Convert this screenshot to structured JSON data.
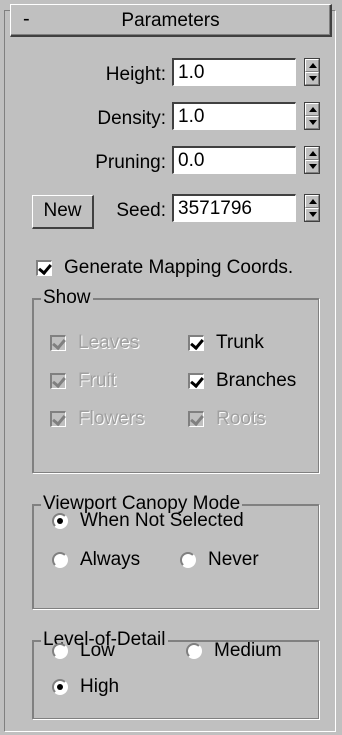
{
  "header": {
    "collapse_symbol": "-",
    "title": "Parameters"
  },
  "params": [
    {
      "label": "Height:",
      "value": "1.0"
    },
    {
      "label": "Density:",
      "value": "1.0"
    },
    {
      "label": "Pruning:",
      "value": "0.0"
    }
  ],
  "seed": {
    "button_label": "New",
    "label": "Seed:",
    "value": "3571796"
  },
  "generate_mapping": {
    "label": "Generate Mapping Coords.",
    "checked": true
  },
  "show": {
    "title": "Show",
    "items": [
      {
        "label": "Leaves",
        "checked": true,
        "disabled": true
      },
      {
        "label": "Trunk",
        "checked": true,
        "disabled": false
      },
      {
        "label": "Fruit",
        "checked": true,
        "disabled": true
      },
      {
        "label": "Branches",
        "checked": true,
        "disabled": false
      },
      {
        "label": "Flowers",
        "checked": true,
        "disabled": true
      },
      {
        "label": "Roots",
        "checked": true,
        "disabled": true
      }
    ]
  },
  "viewport_canopy": {
    "title": "Viewport Canopy Mode",
    "options": [
      {
        "label": "When Not Selected",
        "selected": true
      },
      {
        "label": "Always",
        "selected": false
      },
      {
        "label": "Never",
        "selected": false
      }
    ]
  },
  "lod": {
    "title": "Level-of-Detail",
    "options": [
      {
        "label": "Low",
        "selected": false
      },
      {
        "label": "Medium",
        "selected": false
      },
      {
        "label": "High",
        "selected": true
      }
    ]
  },
  "colors": {
    "panel_bg": "#c0c0c0",
    "disabled_text": "#a0a0a0"
  }
}
